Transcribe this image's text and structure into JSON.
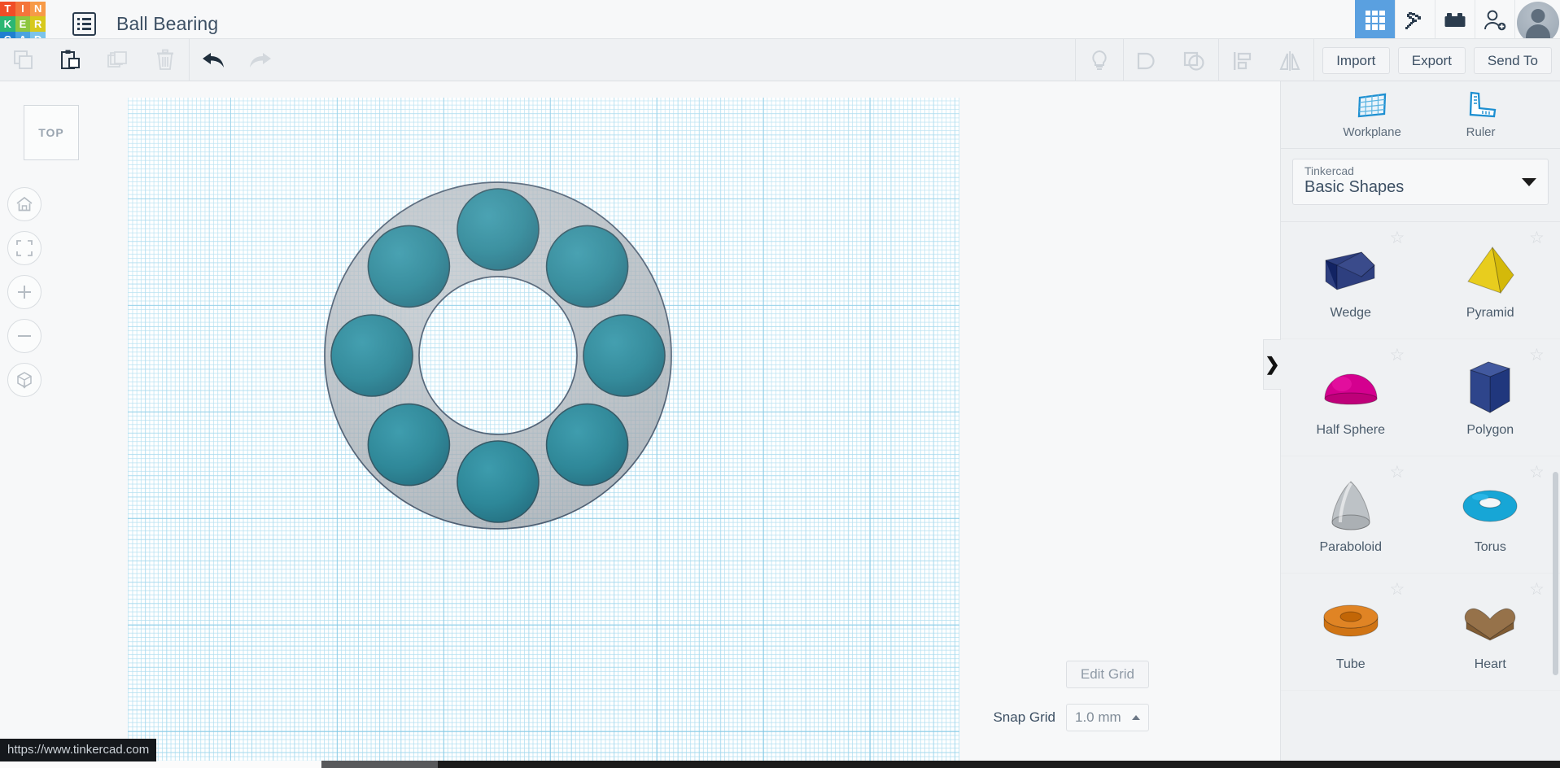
{
  "app": {
    "brand_letters": [
      {
        "ch": "T",
        "color": "#f04d27"
      },
      {
        "ch": "I",
        "color": "#f4743b"
      },
      {
        "ch": "N",
        "color": "#f79a47"
      },
      {
        "ch": "K",
        "color": "#2bb673"
      },
      {
        "ch": "E",
        "color": "#8dc63f"
      },
      {
        "ch": "R",
        "color": "#d7c91c"
      },
      {
        "ch": "C",
        "color": "#1f7fd0"
      },
      {
        "ch": "A",
        "color": "#4aa3e0"
      },
      {
        "ch": "D",
        "color": "#7cc3ea"
      }
    ],
    "design_title": "Ball Bearing",
    "gallery_icon": "documents-list-icon"
  },
  "topbar_right": {
    "items": [
      {
        "name": "3d-designs-grid-icon",
        "label": "3D Designs",
        "active": true
      },
      {
        "name": "minecraft-pickaxe-icon",
        "label": "Minecraft",
        "active": false
      },
      {
        "name": "lego-brick-icon",
        "label": "Bricks",
        "active": false
      },
      {
        "name": "add-person-icon",
        "label": "Invite",
        "active": false
      }
    ],
    "avatar_name": "user-avatar"
  },
  "toolbar": {
    "left_tools": [
      {
        "name": "copy-icon",
        "label": "Copy",
        "enabled": false
      },
      {
        "name": "paste-icon",
        "label": "Paste",
        "enabled": true
      },
      {
        "name": "duplicate-icon",
        "label": "Duplicate",
        "enabled": false
      },
      {
        "name": "delete-trash-icon",
        "label": "Delete",
        "enabled": false
      },
      {
        "name": "undo-arrow-icon",
        "label": "Undo",
        "enabled": true
      },
      {
        "name": "redo-arrow-icon",
        "label": "Redo",
        "enabled": false
      }
    ],
    "right_tools": [
      {
        "name": "lightbulb-notes-icon",
        "label": "Notes",
        "enabled": false
      },
      {
        "name": "group-shapes-icon",
        "label": "Group",
        "enabled": false
      },
      {
        "name": "ungroup-shapes-icon",
        "label": "Ungroup",
        "enabled": false
      },
      {
        "name": "align-icon",
        "label": "Align",
        "enabled": false
      },
      {
        "name": "mirror-flip-icon",
        "label": "Mirror",
        "enabled": false
      }
    ],
    "import_label": "Import",
    "export_label": "Export",
    "send_to_label": "Send To"
  },
  "canvas": {
    "view_cube_label": "TOP",
    "nav_buttons": [
      {
        "name": "home-view-icon",
        "label": "Home View"
      },
      {
        "name": "fit-to-view-icon",
        "label": "Fit All in View"
      },
      {
        "name": "zoom-in-icon",
        "label": "Zoom In"
      },
      {
        "name": "zoom-out-icon",
        "label": "Zoom Out"
      },
      {
        "name": "perspective-toggle-icon",
        "label": "Switch to Orthographic View"
      }
    ],
    "edit_grid_label": "Edit Grid",
    "snap_grid_label": "Snap Grid",
    "snap_grid_value": "1.0 mm",
    "model": {
      "name": "ball-bearing-model",
      "ring_color": "#8b9299",
      "ball_color": "#1b7a8c",
      "ball_count": 8,
      "outline_color": "#2c3e56"
    }
  },
  "right_panel": {
    "workplane_label": "Workplane",
    "ruler_label": "Ruler",
    "library_category": "Tinkercad",
    "library_name": "Basic Shapes",
    "collapse_glyph": "❯",
    "shapes": [
      {
        "label": "Wedge",
        "color": "#2e3f7f",
        "art": "wedge"
      },
      {
        "label": "Pyramid",
        "color": "#e8cd1e",
        "art": "pyramid"
      },
      {
        "label": "Half Sphere",
        "color": "#d4008f",
        "art": "halfsphere"
      },
      {
        "label": "Polygon",
        "color": "#32498f",
        "art": "polygon"
      },
      {
        "label": "Paraboloid",
        "color": "#bdc2c6",
        "art": "paraboloid"
      },
      {
        "label": "Torus",
        "color": "#17a6d6",
        "art": "torus"
      },
      {
        "label": "Tube",
        "color": "#e08424",
        "art": "tube"
      },
      {
        "label": "Heart",
        "color": "#96724a",
        "art": "heart"
      }
    ],
    "star_glyph": "☆"
  },
  "status": {
    "url": "https://www.tinkercad.com"
  }
}
